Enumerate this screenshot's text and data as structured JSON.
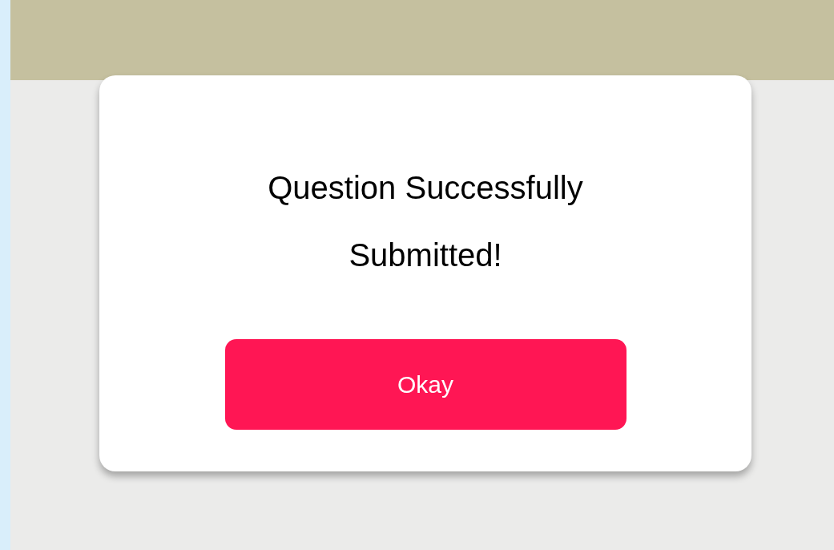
{
  "dialog": {
    "message": "Question Successfully Submitted!",
    "button": {
      "label": "Okay"
    }
  }
}
